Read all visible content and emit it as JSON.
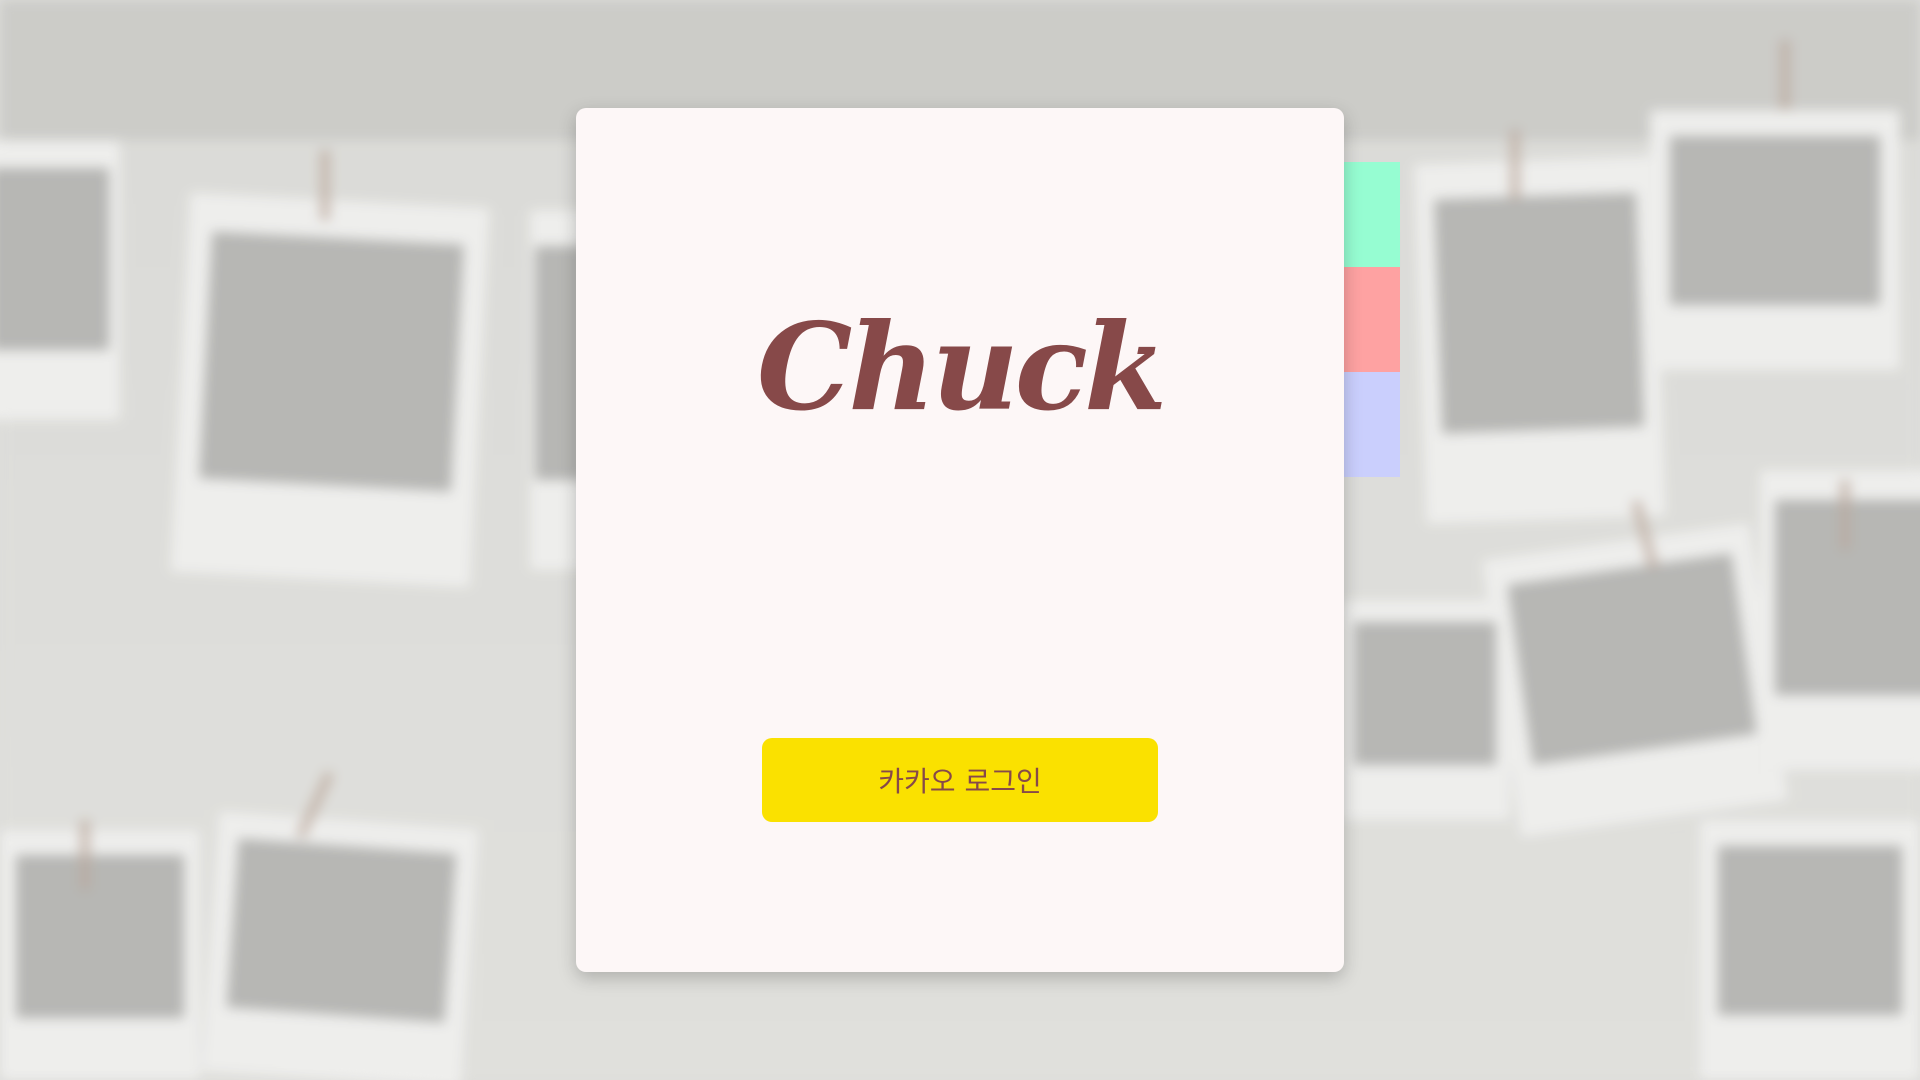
{
  "app": {
    "logo_text": "Chuck"
  },
  "login": {
    "kakao_button_label": "카카오 로그인"
  },
  "theme": {
    "card_background": "#fdf7f7",
    "logo_color": "#874949",
    "kakao_button_color": "#fae100",
    "kakao_button_text_color": "#874949",
    "tab_colors": [
      "#96fdd2",
      "#fea2a2",
      "#cacffd"
    ]
  }
}
